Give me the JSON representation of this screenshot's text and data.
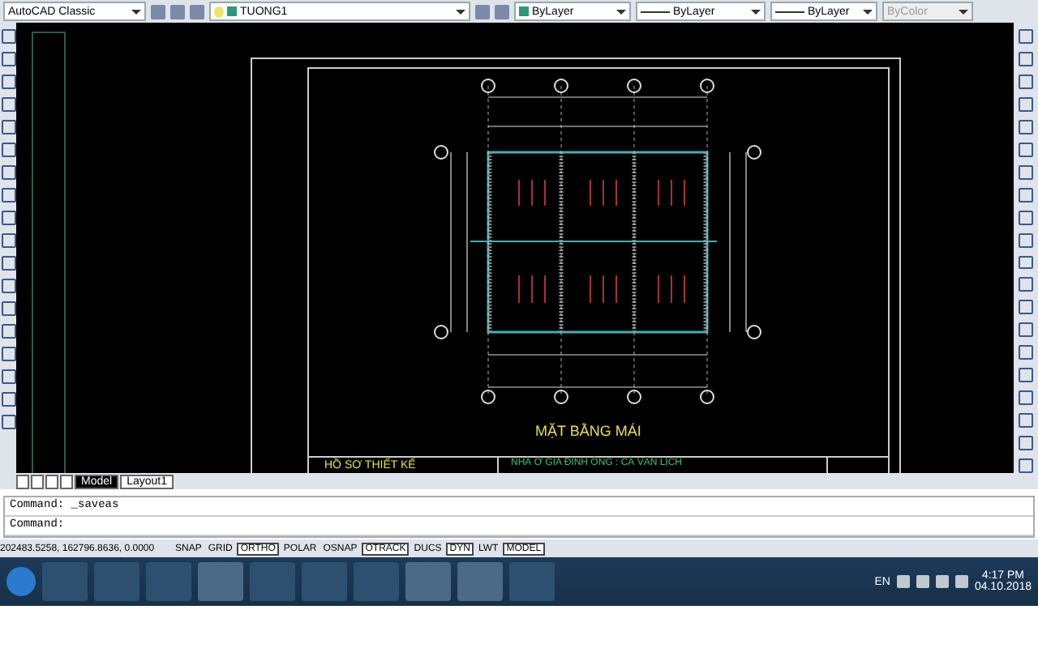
{
  "toolbar": {
    "workspace": "AutoCAD Classic",
    "layer": "TUONG1",
    "color_control": "ByLayer",
    "linetype": "ByLayer",
    "lineweight": "ByLayer",
    "plot_style": {
      "label": "ByColor",
      "disabled": true
    }
  },
  "drawing": {
    "title": "MẶT BẰNG MÁI",
    "project_label": "HỒ SƠ THIẾT KẾ",
    "owner": "NHÀ Ở GIA ĐÌNH ÔNG : CÀ VĂN LỊCH"
  },
  "layout_tabs": [
    {
      "label": "Model",
      "selected": true
    },
    {
      "label": "Layout1",
      "selected": false
    }
  ],
  "command_history": "Command: _saveas",
  "command_prompt": "Command:",
  "coordinates": "202483.5258, 162796.8636, 0.0000",
  "status_toggles": [
    {
      "label": "SNAP",
      "on": false
    },
    {
      "label": "GRID",
      "on": false
    },
    {
      "label": "ORTHO",
      "on": true
    },
    {
      "label": "POLAR",
      "on": false
    },
    {
      "label": "OSNAP",
      "on": false
    },
    {
      "label": "OTRACK",
      "on": true
    },
    {
      "label": "DUCS",
      "on": false
    },
    {
      "label": "DYN",
      "on": true
    },
    {
      "label": "LWT",
      "on": false
    },
    {
      "label": "MODEL",
      "on": true
    }
  ],
  "taskbar": {
    "language": "EN",
    "time": "4:17 PM",
    "date": "04.10.2018"
  }
}
